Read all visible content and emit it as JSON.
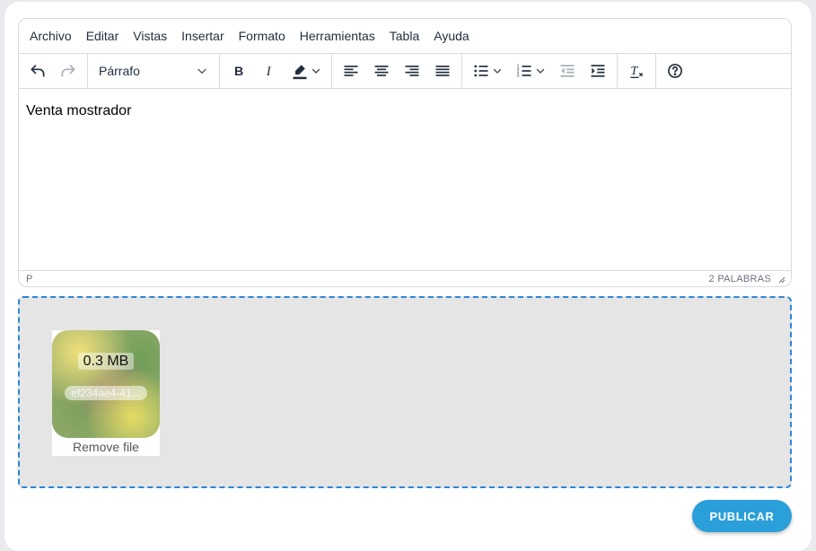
{
  "menubar": {
    "items": [
      "Archivo",
      "Editar",
      "Vistas",
      "Insertar",
      "Formato",
      "Herramientas",
      "Tabla",
      "Ayuda"
    ]
  },
  "toolbar": {
    "block_format": "Párrafo",
    "icons": {
      "undo": "undo-icon",
      "redo": "redo-icon",
      "bold": "bold-icon",
      "italic": "italic-icon",
      "highlight": "highlight-color-icon",
      "align_left": "align-left-icon",
      "align_center": "align-center-icon",
      "align_right": "align-right-icon",
      "justify": "align-justify-icon",
      "bullet_list": "bullet-list-icon",
      "numbered_list": "numbered-list-icon",
      "outdent": "outdent-icon",
      "indent": "indent-icon",
      "clear_format": "clear-formatting-icon",
      "help": "help-icon"
    }
  },
  "editor": {
    "content": "Venta mostrador",
    "status_path": "P",
    "word_count": "2 PALABRAS"
  },
  "upload": {
    "file_size": "0.3 MB",
    "file_name": "ef234ae4-41...",
    "remove_label": "Remove file"
  },
  "actions": {
    "publish_label": "PUBLICAR"
  },
  "colors": {
    "accent": "#2b9fd9",
    "dropzone_border": "#2a85d8",
    "dropzone_bg": "#e5e5e5"
  }
}
